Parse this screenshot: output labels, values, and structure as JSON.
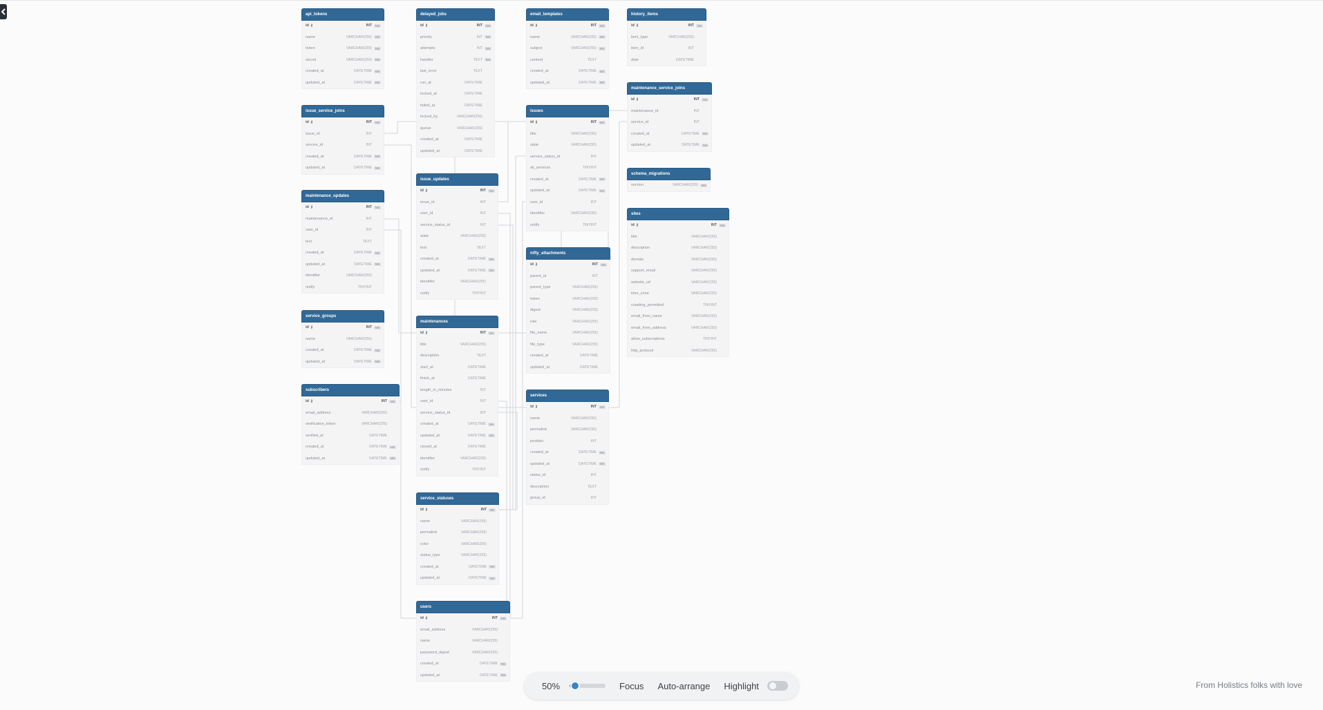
{
  "toolbar": {
    "zoom_label": "50%",
    "zoom_value": 0.5,
    "focus_label": "Focus",
    "auto_arrange_label": "Auto-arrange",
    "highlight_label": "Highlight",
    "highlight_on": false
  },
  "footer": {
    "credit": "From Holistics folks with love"
  },
  "colors": {
    "header": "#316896",
    "accent": "#3b82c4"
  },
  "tables": [
    {
      "name": "api_tokens",
      "cols": [
        [
          "id",
          "INT",
          1,
          1
        ],
        [
          "name",
          "VARCHAR(255)",
          1
        ],
        [
          "token",
          "VARCHAR(255)",
          1
        ],
        [
          "secret",
          "VARCHAR(255)",
          1
        ],
        [
          "created_at",
          "DATETIME",
          1
        ],
        [
          "updated_at",
          "DATETIME",
          1
        ]
      ]
    },
    {
      "name": "delayed_jobs",
      "cols": [
        [
          "id",
          "INT",
          1,
          1
        ],
        [
          "priority",
          "INT",
          1
        ],
        [
          "attempts",
          "INT",
          1
        ],
        [
          "handler",
          "TEXT",
          1
        ],
        [
          "last_error",
          "TEXT",
          0
        ],
        [
          "run_at",
          "DATETIME",
          0
        ],
        [
          "locked_at",
          "DATETIME",
          0
        ],
        [
          "failed_at",
          "DATETIME",
          0
        ],
        [
          "locked_by",
          "VARCHAR(255)",
          0
        ],
        [
          "queue",
          "VARCHAR(255)",
          0
        ],
        [
          "created_at",
          "DATETIME",
          0
        ],
        [
          "updated_at",
          "DATETIME",
          0
        ]
      ]
    },
    {
      "name": "email_templates",
      "cols": [
        [
          "id",
          "INT",
          1,
          1
        ],
        [
          "name",
          "VARCHAR(255)",
          1
        ],
        [
          "subject",
          "VARCHAR(255)",
          1
        ],
        [
          "content",
          "TEXT",
          0
        ],
        [
          "created_at",
          "DATETIME",
          1
        ],
        [
          "updated_at",
          "DATETIME",
          1
        ]
      ]
    },
    {
      "name": "history_items",
      "cols": [
        [
          "id",
          "INT",
          1,
          1
        ],
        [
          "item_type",
          "VARCHAR(255)",
          0
        ],
        [
          "item_id",
          "INT",
          0
        ],
        [
          "date",
          "DATETIME",
          0
        ]
      ]
    },
    {
      "name": "issue_service_joins",
      "cols": [
        [
          "id",
          "INT",
          1,
          1
        ],
        [
          "issue_id",
          "INT",
          0
        ],
        [
          "service_id",
          "INT",
          0
        ],
        [
          "created_at",
          "DATETIME",
          1
        ],
        [
          "updated_at",
          "DATETIME",
          1
        ]
      ]
    },
    {
      "name": "issues",
      "cols": [
        [
          "id",
          "INT",
          1,
          1
        ],
        [
          "title",
          "VARCHAR(255)",
          0
        ],
        [
          "state",
          "VARCHAR(255)",
          0
        ],
        [
          "service_status_id",
          "INT",
          0
        ],
        [
          "all_services",
          "TINYINT",
          0
        ],
        [
          "created_at",
          "DATETIME",
          1
        ],
        [
          "updated_at",
          "DATETIME",
          1
        ],
        [
          "user_id",
          "INT",
          0
        ],
        [
          "identifier",
          "VARCHAR(255)",
          0
        ],
        [
          "notify",
          "TINYINT",
          0
        ]
      ]
    },
    {
      "name": "maintenance_service_joins",
      "cols": [
        [
          "id",
          "INT",
          1,
          1
        ],
        [
          "maintenance_id",
          "INT",
          0
        ],
        [
          "service_id",
          "INT",
          0
        ],
        [
          "created_at",
          "DATETIME",
          1
        ],
        [
          "updated_at",
          "DATETIME",
          1
        ]
      ]
    },
    {
      "name": "schema_migrations",
      "cols": [
        [
          "version",
          "VARCHAR(255)",
          1
        ]
      ]
    },
    {
      "name": "issue_updates",
      "cols": [
        [
          "id",
          "INT",
          1,
          1
        ],
        [
          "issue_id",
          "INT",
          0
        ],
        [
          "user_id",
          "INT",
          0
        ],
        [
          "service_status_id",
          "INT",
          0
        ],
        [
          "state",
          "VARCHAR(255)",
          0
        ],
        [
          "text",
          "TEXT",
          0
        ],
        [
          "created_at",
          "DATETIME",
          1
        ],
        [
          "updated_at",
          "DATETIME",
          1
        ],
        [
          "identifier",
          "VARCHAR(255)",
          0
        ],
        [
          "notify",
          "TINYINT",
          0
        ]
      ]
    },
    {
      "name": "maintenance_updates",
      "cols": [
        [
          "id",
          "INT",
          1,
          1
        ],
        [
          "maintenance_id",
          "INT",
          0
        ],
        [
          "user_id",
          "INT",
          0
        ],
        [
          "text",
          "TEXT",
          0
        ],
        [
          "created_at",
          "DATETIME",
          1
        ],
        [
          "updated_at",
          "DATETIME",
          1
        ],
        [
          "identifier",
          "VARCHAR(255)",
          0
        ],
        [
          "notify",
          "TINYINT",
          0
        ]
      ]
    },
    {
      "name": "sites",
      "cols": [
        [
          "id",
          "INT",
          1,
          1
        ],
        [
          "title",
          "VARCHAR(255)",
          0
        ],
        [
          "description",
          "VARCHAR(255)",
          0
        ],
        [
          "domain",
          "VARCHAR(255)",
          0
        ],
        [
          "support_email",
          "VARCHAR(255)",
          0
        ],
        [
          "website_url",
          "VARCHAR(255)",
          0
        ],
        [
          "time_zone",
          "VARCHAR(255)",
          0
        ],
        [
          "crawling_permitted",
          "TINYINT",
          0
        ],
        [
          "email_from_name",
          "VARCHAR(255)",
          0
        ],
        [
          "email_from_address",
          "VARCHAR(255)",
          0
        ],
        [
          "allow_subscriptions",
          "TINYINT",
          0
        ],
        [
          "http_protocol",
          "VARCHAR(255)",
          0
        ]
      ]
    },
    {
      "name": "nifty_attachments",
      "cols": [
        [
          "id",
          "INT",
          1,
          1
        ],
        [
          "parent_id",
          "INT",
          0
        ],
        [
          "parent_type",
          "VARCHAR(255)",
          0
        ],
        [
          "token",
          "VARCHAR(255)",
          0
        ],
        [
          "digest",
          "VARCHAR(255)",
          0
        ],
        [
          "role",
          "VARCHAR(255)",
          0
        ],
        [
          "file_name",
          "VARCHAR(255)",
          0
        ],
        [
          "file_type",
          "VARCHAR(255)",
          0
        ],
        [
          "created_at",
          "DATETIME",
          0
        ],
        [
          "updated_at",
          "DATETIME",
          0
        ]
      ]
    },
    {
      "name": "service_groups",
      "cols": [
        [
          "id",
          "INT",
          1,
          1
        ],
        [
          "name",
          "VARCHAR(255)",
          0
        ],
        [
          "created_at",
          "DATETIME",
          1
        ],
        [
          "updated_at",
          "DATETIME",
          1
        ]
      ]
    },
    {
      "name": "maintenances",
      "cols": [
        [
          "id",
          "INT",
          1,
          1
        ],
        [
          "title",
          "VARCHAR(255)",
          0
        ],
        [
          "description",
          "TEXT",
          0
        ],
        [
          "start_at",
          "DATETIME",
          0
        ],
        [
          "finish_at",
          "DATETIME",
          0
        ],
        [
          "length_in_minutes",
          "INT",
          0
        ],
        [
          "user_id",
          "INT",
          0
        ],
        [
          "service_status_id",
          "INT",
          0
        ],
        [
          "created_at",
          "DATETIME",
          1
        ],
        [
          "updated_at",
          "DATETIME",
          1
        ],
        [
          "closed_at",
          "DATETIME",
          0
        ],
        [
          "identifier",
          "VARCHAR(255)",
          0
        ],
        [
          "notify",
          "TINYINT",
          0
        ]
      ]
    },
    {
      "name": "subscribers",
      "cols": [
        [
          "id",
          "INT",
          1,
          1
        ],
        [
          "email_address",
          "VARCHAR(255)",
          0
        ],
        [
          "verification_token",
          "VARCHAR(255)",
          0
        ],
        [
          "verified_at",
          "DATETIME",
          0
        ],
        [
          "created_at",
          "DATETIME",
          1
        ],
        [
          "updated_at",
          "DATETIME",
          1
        ]
      ]
    },
    {
      "name": "services",
      "cols": [
        [
          "id",
          "INT",
          1,
          1
        ],
        [
          "name",
          "VARCHAR(255)",
          0
        ],
        [
          "permalink",
          "VARCHAR(255)",
          0
        ],
        [
          "position",
          "INT",
          0
        ],
        [
          "created_at",
          "DATETIME",
          1
        ],
        [
          "updated_at",
          "DATETIME",
          1
        ],
        [
          "status_id",
          "INT",
          0
        ],
        [
          "description",
          "TEXT",
          0
        ],
        [
          "group_id",
          "INT",
          0
        ]
      ]
    },
    {
      "name": "service_statuses",
      "cols": [
        [
          "id",
          "INT",
          1,
          1
        ],
        [
          "name",
          "VARCHAR(255)",
          0
        ],
        [
          "permalink",
          "VARCHAR(255)",
          0
        ],
        [
          "color",
          "VARCHAR(255)",
          0
        ],
        [
          "status_type",
          "VARCHAR(255)",
          0
        ],
        [
          "created_at",
          "DATETIME",
          1
        ],
        [
          "updated_at",
          "DATETIME",
          1
        ]
      ]
    },
    {
      "name": "users",
      "cols": [
        [
          "id",
          "INT",
          1,
          1
        ],
        [
          "email_address",
          "VARCHAR(255)",
          0
        ],
        [
          "name",
          "VARCHAR(255)",
          0
        ],
        [
          "password_digest",
          "VARCHAR(255)",
          0
        ],
        [
          "created_at",
          "DATETIME",
          1
        ],
        [
          "updated_at",
          "DATETIME",
          1
        ]
      ]
    }
  ]
}
